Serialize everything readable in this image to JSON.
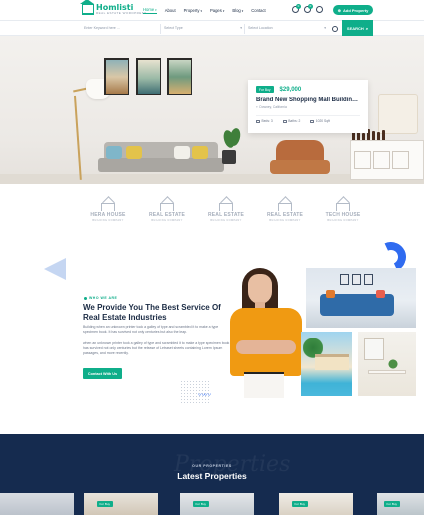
{
  "header": {
    "logo_name": "Homlisti",
    "logo_tagline": "REAL ESTATE WORDPRESS",
    "nav": [
      {
        "label": "Home",
        "dropdown": true,
        "active": true
      },
      {
        "label": "About",
        "dropdown": false,
        "active": false
      },
      {
        "label": "Property",
        "dropdown": true,
        "active": false
      },
      {
        "label": "Pages",
        "dropdown": true,
        "active": false
      },
      {
        "label": "Blog",
        "dropdown": true,
        "active": false
      },
      {
        "label": "Contact",
        "dropdown": false,
        "active": false
      }
    ],
    "icons": [
      {
        "name": "compare-icon",
        "badge": "0"
      },
      {
        "name": "heart-icon",
        "badge": "0"
      },
      {
        "name": "user-icon",
        "badge": ""
      }
    ],
    "add_property_label": "Add Property"
  },
  "search": {
    "keyword_placeholder": "Enter Keyword here ...",
    "type_placeholder": "Select Type",
    "location_placeholder": "Select Location",
    "button_label": "SEARCH"
  },
  "hero_card": {
    "tag": "For Buy",
    "price": "$29,000",
    "title": "Brand New Shopping Mall Building for Sale",
    "address": "Downey, California",
    "features": [
      {
        "icon": "bed-icon",
        "label": "Beds: 3"
      },
      {
        "icon": "bath-icon",
        "label": "Baths: 2"
      },
      {
        "icon": "area-icon",
        "label": "1020 Sqft"
      }
    ]
  },
  "brands": [
    {
      "name": "HERA HOUSE",
      "sub": "BUILDING COMPANY"
    },
    {
      "name": "REAL ESTATE",
      "sub": "BUILDING COMPANY"
    },
    {
      "name": "REAL ESTATE",
      "sub": "BUILDING COMPANY"
    },
    {
      "name": "REAL ESTATE",
      "sub": "BUILDING COMPANY"
    },
    {
      "name": "TECH HOUSE",
      "sub": "BUILDING COMPANY"
    }
  ],
  "about": {
    "kicker": "WHO WE ARE",
    "title": "We Provide You The Best Service Of Real Estate Industries",
    "paragraph1": "Building when an unknown printer took a galley of type and scrambled it to make a type specimen book. It has survived not only centuries but also the leap.",
    "paragraph2": "when an unknown printer took a galley of type and scrambled it to make a type specimen book has survived not only centuries but the release of Letraset sheets containing Lorem Ipsum passages, and more recently.",
    "button_label": "Contact With Us"
  },
  "latest": {
    "background_word": "Properties",
    "kicker": "OUR PROPERTIES",
    "title": "Latest Properties",
    "cards": [
      {
        "tag": ""
      },
      {
        "tag": "For Buy"
      },
      {
        "tag": "For Buy"
      },
      {
        "tag": "For Buy"
      },
      {
        "tag": "For Buy"
      }
    ]
  },
  "colors": {
    "accent": "#0fae8a",
    "navy": "#152b4f",
    "blue_accent": "#2f6bf0",
    "orange": "#f09a12"
  }
}
